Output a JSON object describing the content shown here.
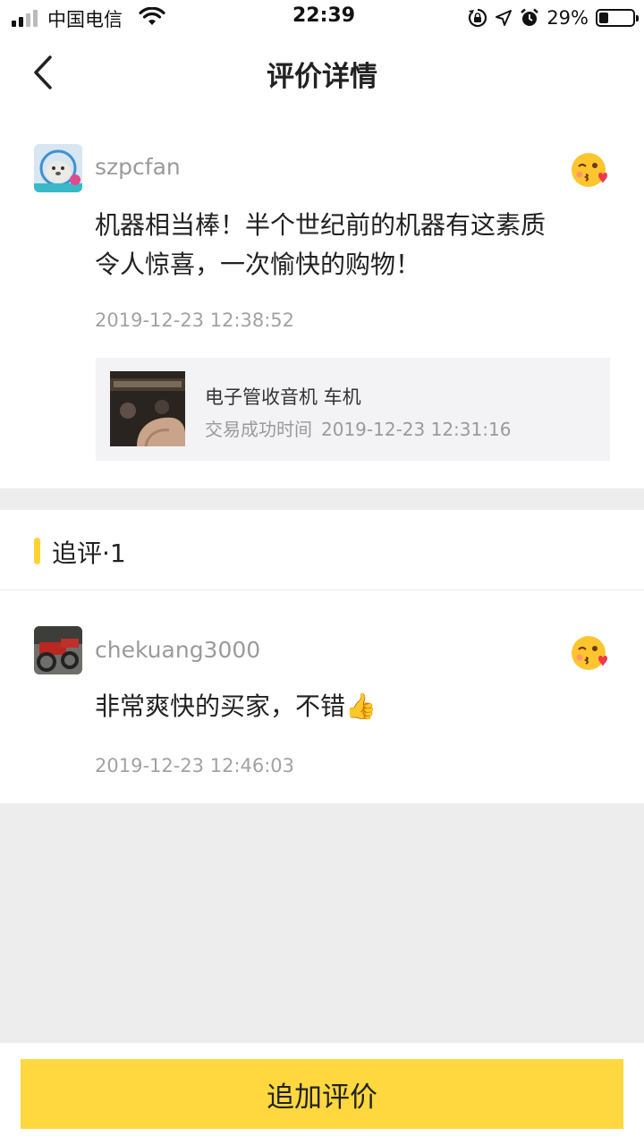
{
  "status_bar": {
    "carrier": "中国电信",
    "time": "22:39",
    "battery_percent": "29%",
    "battery_level": 0.29,
    "icons": [
      "signal-icon",
      "wifi-icon",
      "rotation-lock-icon",
      "location-icon",
      "alarm-icon",
      "battery-icon"
    ]
  },
  "nav": {
    "title": "评价详情",
    "back_icon": "chevron-left-icon"
  },
  "review": {
    "username": "szpcfan",
    "text_line1": "机器相当棒！半个世纪前的机器有这素质",
    "text_line2": "令人惊喜，一次愉快的购物！",
    "timestamp": "2019-12-23 12:38:52",
    "reaction_icon": "kiss-emoji-icon",
    "product": {
      "name": "电子管收音机 车机",
      "time_label": "交易成功时间",
      "time_value": "2019-12-23 12:31:16"
    }
  },
  "followup": {
    "section_title": "追评·1",
    "username": "chekuang3000",
    "text": "非常爽快的买家，不错",
    "text_emoji": "👍",
    "timestamp": "2019-12-23 12:46:03",
    "reaction_icon": "kiss-emoji-icon"
  },
  "bottom": {
    "add_review_label": "追加评价"
  },
  "colors": {
    "accent_yellow": "#ffd83f",
    "section_bar": "#ffd234",
    "muted_text": "#9a9a9a",
    "page_bg": "#ededed"
  }
}
